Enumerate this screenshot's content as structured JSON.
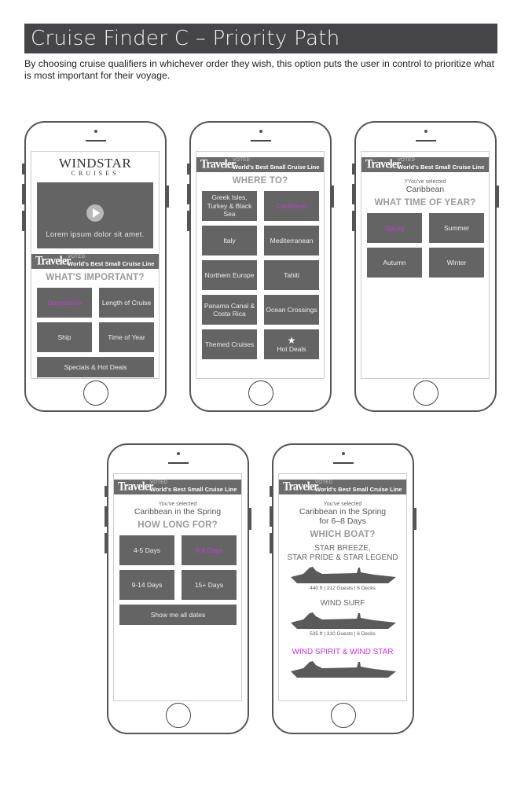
{
  "page": {
    "title": "Cruise Finder C – Priority Path",
    "description": "By choosing cruise qualifiers in whichever order they wish, this option puts the user in control to prioritize what is most important for their voyage."
  },
  "brand": {
    "logo_main": "WINDSTAR",
    "logo_sub": "CRUISES",
    "award_logo": "Traveler",
    "award_voted": "VOTED",
    "award_text": "World's Best Small Cruise Line"
  },
  "colors": {
    "title_bar": "#454547",
    "tile": "#646464",
    "selected": "#c040d0",
    "heading": "#9a9a9a"
  },
  "screens": [
    {
      "video_caption": "Lorem ipsum dolor sit amet.",
      "heading": "WHAT'S IMPORTANT?",
      "options": [
        {
          "label": "Desitnation",
          "selected": true
        },
        {
          "label": "Length of Cruise",
          "selected": false
        },
        {
          "label": "Ship",
          "selected": false
        },
        {
          "label": "Time of Year",
          "selected": false
        },
        {
          "label": "Specials & Hot Deals",
          "selected": false
        }
      ]
    },
    {
      "heading": "WHERE TO?",
      "options": [
        {
          "label": "Greek Isles, Turkey & Black Sea",
          "selected": false
        },
        {
          "label": "Caribbean",
          "selected": true
        },
        {
          "label": "Italy",
          "selected": false
        },
        {
          "label": "Mediterranean",
          "selected": false
        },
        {
          "label": "Northern Europe",
          "selected": false
        },
        {
          "label": "Tahiti",
          "selected": false
        },
        {
          "label": "Panama Canal & Costa Rica",
          "selected": false
        },
        {
          "label": "Ocean Crossings",
          "selected": false
        },
        {
          "label": "Themed Cruises",
          "selected": false
        },
        {
          "label": "Hot Deals",
          "selected": false,
          "icon": "star-icon"
        }
      ]
    },
    {
      "selected_prefix": "YYou've selected",
      "selected_value": "Caribbean",
      "heading": "WHAT TIME OF YEAR?",
      "options": [
        {
          "label": "Spring",
          "selected": true
        },
        {
          "label": "Summer",
          "selected": false
        },
        {
          "label": "Autumn",
          "selected": false
        },
        {
          "label": "Winter",
          "selected": false
        }
      ]
    },
    {
      "selected_prefix": "You've selected",
      "selected_value": "Caribbean in the Spring",
      "heading": "HOW LONG FOR?",
      "options": [
        {
          "label": "4-5 Days",
          "selected": false
        },
        {
          "label": "6-8 Days",
          "selected": true
        },
        {
          "label": "9-14 Days",
          "selected": false
        },
        {
          "label": "15+ Days",
          "selected": false
        },
        {
          "label": "Show me all dates",
          "selected": false
        }
      ]
    },
    {
      "selected_prefix": "You've selected",
      "selected_value": "Caribbean in the Spring",
      "selected_value_2": "for 6–8 Days",
      "heading": "WHICH BOAT?",
      "boats": [
        {
          "name": "STAR BREEZE,",
          "name_2": "STAR PRIDE & STAR LEGEND",
          "specs": "440 ft  |  212 Guests  |  6 Decks",
          "selected": false
        },
        {
          "name": "WIND SURF",
          "specs": "535 ft  |  310 Guests  |  6 Decks",
          "selected": false
        },
        {
          "name": "WIND SPIRIT & WIND STAR",
          "selected": true
        }
      ]
    }
  ]
}
